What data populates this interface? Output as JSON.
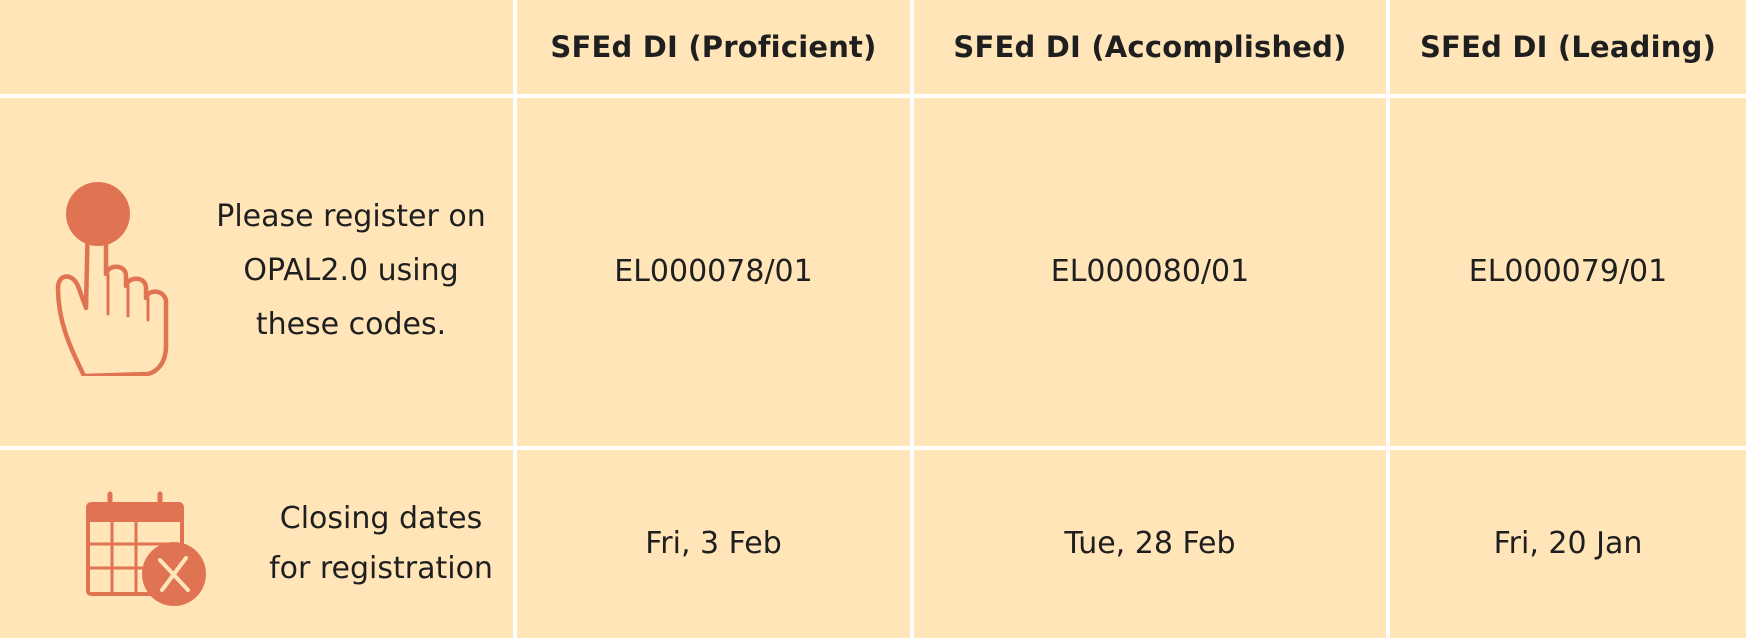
{
  "table": {
    "columns": [
      "SFEd DI (Proficient)",
      "SFEd DI (Accomplished)",
      "SFEd DI (Leading)"
    ],
    "rows": [
      {
        "label_lines": [
          "Please register on",
          "OPAL2.0 using",
          "these codes."
        ],
        "icon": "pointing-hand-icon",
        "cells": [
          "EL000078/01",
          "EL000080/01",
          "EL000079/01"
        ]
      },
      {
        "label_lines": [
          "Closing dates",
          "for registration"
        ],
        "icon": "calendar-cancel-icon",
        "cells": [
          "Fri, 3 Feb",
          "Tue, 28 Feb",
          "Fri, 20 Jan"
        ]
      }
    ]
  },
  "colors": {
    "cell_background": "#ffe5b8",
    "grid_lines": "#ffffff",
    "icon_accent": "#e07452",
    "text": "#1f1f1f"
  }
}
